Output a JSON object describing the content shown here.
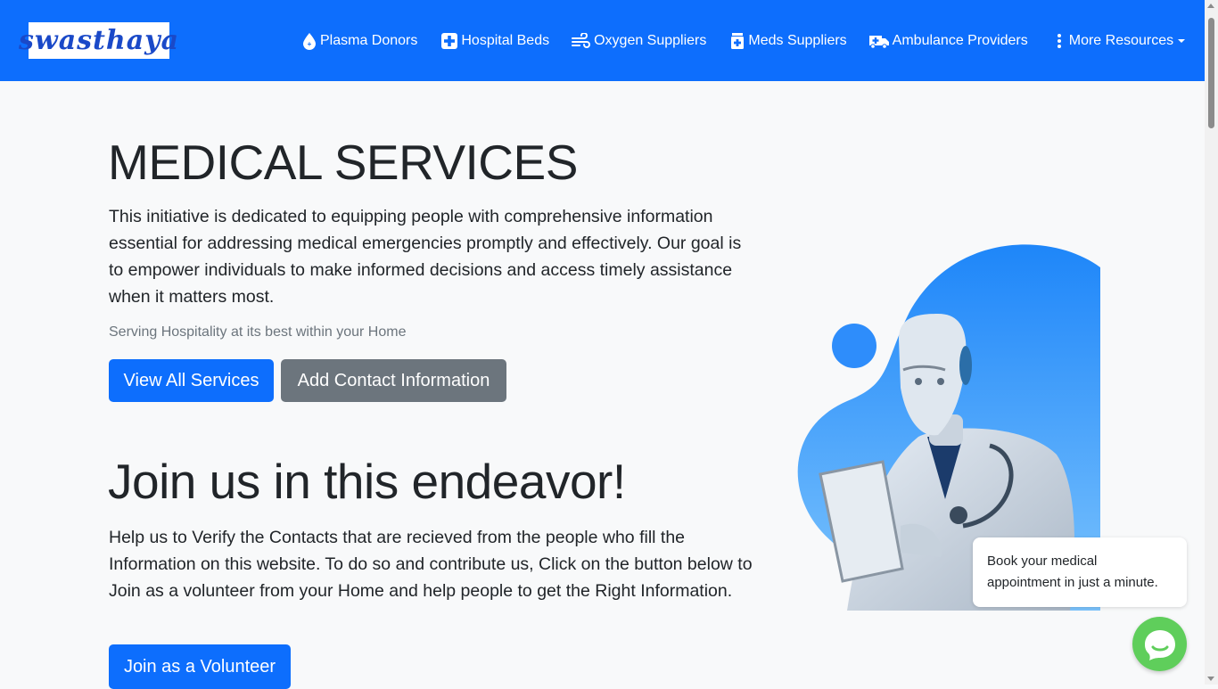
{
  "brand": {
    "logo_text": "swasthaya"
  },
  "nav": {
    "items": [
      {
        "label": "Plasma Donors",
        "icon": "blood-drop-icon"
      },
      {
        "label": "Hospital Beds",
        "icon": "hospital-plus-icon"
      },
      {
        "label": "Oxygen Suppliers",
        "icon": "wind-icon"
      },
      {
        "label": "Meds Suppliers",
        "icon": "medicine-bottle-icon"
      },
      {
        "label": "Ambulance Providers",
        "icon": "ambulance-icon"
      },
      {
        "label": "More Resources",
        "icon": "vertical-ellipsis-icon"
      }
    ]
  },
  "hero": {
    "title": "MEDICAL SERVICES",
    "description": "This initiative is dedicated to equipping people with comprehensive information essential for addressing medical emergencies promptly and effectively. Our goal is to empower individuals to make informed decisions and access timely assistance when it matters most.",
    "tagline": "Serving Hospitality at its best within your Home",
    "primary_button": "View All Services",
    "secondary_button": "Add Contact Information"
  },
  "join": {
    "title": "Join us in this endeavor!",
    "description": "Help us to Verify the Contacts that are recieved from the people who fill the Information on this website. To do so and contribute us, Click on the button below to Join as a volunteer from your Home and help people to get the Right Information.",
    "button": "Join as a Volunteer"
  },
  "chat": {
    "message": "Book your medical appointment in just a minute.",
    "icon": "chat-bubble-icon"
  },
  "colors": {
    "primary": "#0d6efd",
    "secondary": "#6c757d",
    "chat": "#5fce5b",
    "illustration": "#2e8dfb"
  }
}
